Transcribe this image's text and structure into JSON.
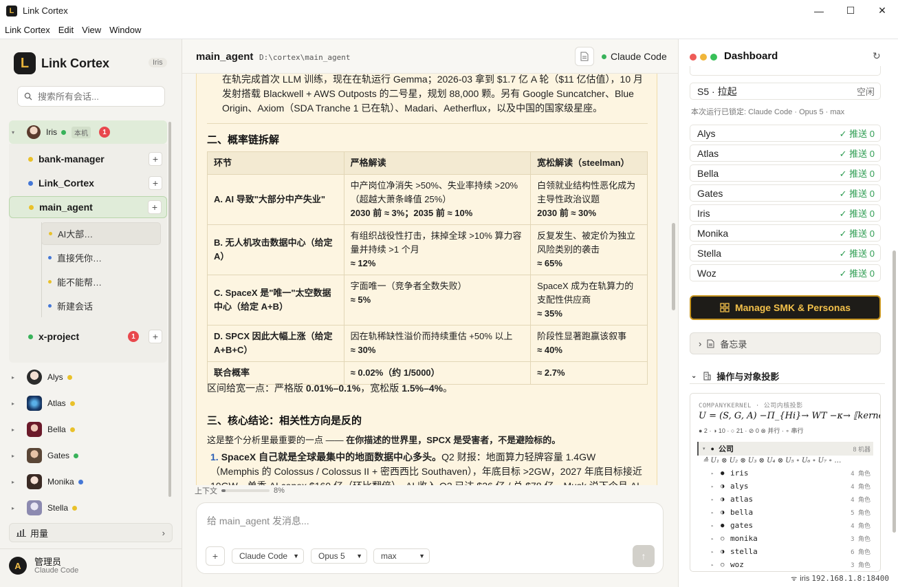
{
  "window": {
    "title": "Link Cortex",
    "controls": [
      "—",
      "☐",
      "✕"
    ]
  },
  "menu": [
    "Link Cortex",
    "Edit",
    "View",
    "Window"
  ],
  "sidebar": {
    "brand": "Link Cortex",
    "user_tag": "Iris",
    "search_placeholder": "搜索所有会话...",
    "root": {
      "name": "Iris",
      "tag": "本机",
      "badge": "1"
    },
    "projects": [
      {
        "name": "bank-manager",
        "color": "#e9c12a"
      },
      {
        "name": "Link_Cortex",
        "color": "#4477d6"
      },
      {
        "name": "main_agent",
        "color": "#e9c12a"
      },
      {
        "name": "x-project",
        "color": "#38b25a",
        "badge": "1"
      }
    ],
    "sessions": [
      {
        "label": "AI大部…",
        "color": "#e9c12a"
      },
      {
        "label": "直接凭你…",
        "color": "#4477d6"
      },
      {
        "label": "能不能帮…",
        "color": "#e9c12a"
      },
      {
        "label": "新建会话",
        "color": "#4477d6"
      }
    ],
    "people": [
      {
        "name": "Alys",
        "color": "#e9c12a"
      },
      {
        "name": "Atlas",
        "color": "#e9c12a"
      },
      {
        "name": "Bella",
        "color": "#e9c12a"
      },
      {
        "name": "Gates",
        "color": "#38b25a"
      },
      {
        "name": "Monika",
        "color": "#4477d6"
      },
      {
        "name": "Stella",
        "color": "#e9c12a"
      }
    ],
    "usage_label": "用量",
    "admin_name": "管理员",
    "admin_sub": "Claude Code",
    "admin_initial": "A"
  },
  "center": {
    "agent": "main_agent",
    "path": "D:\\cortex\\main_agent",
    "runtime": "Claude Code",
    "para_top": "在轨完成首次 LLM 训练，现在在轨运行 Gemma；2026-03 拿到 $1.7 亿 A 轮（$11 亿估值），10 月发射搭载 Blackwell + AWS Outposts 的二号星，规划 88,000 颗。另有 Google Suncatcher、Blue Origin、Axiom（SDA Tranche 1 已在轨）、Madari、Aetherflux，以及中国的国家级星座。",
    "h2": "二、概率链拆解",
    "table_headers": [
      "环节",
      "严格解读",
      "宽松解读（steelman）"
    ],
    "table_rows": [
      {
        "step": "A. AI 导致\"大部分中产失业\"",
        "strict": "中产岗位净消失 >50%、失业率持续 >20%（超越大萧条峰值 25%）",
        "strict_v": "2030 前 ≈ 3%；2035 前 ≈ 10%",
        "loose": "白领就业结构性恶化成为主导性政治议题",
        "loose_v": "2030 前 ≈ 30%"
      },
      {
        "step": "B. 无人机攻击数据中心（给定 A）",
        "strict": "有组织战役性打击，抹掉全球 >10% 算力容量并持续 >1 个月",
        "strict_v": "≈ 12%",
        "loose": "反复发生、被定价为独立风险类别的袭击",
        "loose_v": "≈ 65%"
      },
      {
        "step": "C. SpaceX 是\"唯一\"太空数据中心（给定 A+B）",
        "strict": "字面唯一（竞争者全数失败）",
        "strict_v": "≈ 5%",
        "loose": "SpaceX 成为在轨算力的支配性供应商",
        "loose_v": "≈ 35%"
      },
      {
        "step": "D. SPCX 因此大幅上涨（给定 A+B+C）",
        "strict": "因在轨稀缺性溢价而持续重估 +50% 以上",
        "strict_v": "≈ 30%",
        "loose": "阶段性显著跑赢该叙事",
        "loose_v": "≈ 40%"
      },
      {
        "step": "联合概率",
        "strict": "",
        "strict_v": "≈ 0.02%（约 1/5000）",
        "loose": "",
        "loose_v": "≈ 2.7%"
      }
    ],
    "range_pre": "区间给宽一点：严格版 ",
    "range_strict": "0.01%–0.1%",
    "range_mid": "，宽松版 ",
    "range_loose": "1.5%–4%",
    "range_post": "。",
    "h3": "三、核心结论：相关性方向是反的",
    "lead_pre": "这是整个分析里最重要的一点 —— ",
    "lead_bold": "在你描述的世界里，SPCX 是受害者，不是避险标的。",
    "li_num": "1.",
    "li_bold": "SpaceX 自己就是全球最集中的地面数据中心多头。",
    "li_text": "Q2 财报：地面算力轻牌容量 1.4GW（Memphis 的 Colossus / Colossus II + 密西西比 Southaven），年底目标 >2GW，2027 年底目标接近 10GW，单季 AI capex $160 亿（环比翻倍），AI 收入 Q2 已达 $26 亿 / 总 $78 亿，Musk 说下个月 AI 就会成",
    "context_label": "上下文",
    "context_pct": "8%",
    "context_value": 0.08,
    "composer_placeholder": "给 main_agent 发消息...",
    "sel_runtime": "Claude Code",
    "sel_model": "Opus 5",
    "sel_effort": "max"
  },
  "right": {
    "title": "Dashboard",
    "s5_name": "S5 · 拉起",
    "s5_status": "空闲",
    "locked_text": "本次运行已锁定: Claude Code · Opus 5 · max",
    "personas": [
      {
        "name": "Alys",
        "status": "✓ 推送 0"
      },
      {
        "name": "Atlas",
        "status": "✓ 推送 0"
      },
      {
        "name": "Bella",
        "status": "✓ 推送 0"
      },
      {
        "name": "Gates",
        "status": "✓ 推送 0"
      },
      {
        "name": "Iris",
        "status": "✓ 推送 0"
      },
      {
        "name": "Monika",
        "status": "✓ 推送 0"
      },
      {
        "name": "Stella",
        "status": "✓ 推送 0"
      },
      {
        "name": "Woz",
        "status": "✓ 推送 0"
      }
    ],
    "smk_button": "Manage SMK & Personas",
    "memo_label": "备忘录",
    "ops_label": "操作与对象投影",
    "kernel_title": "COMPANYKERNEL · 公司内核投影",
    "kernel_formula": "U = (S, G, A) −Π_{Hi}→ WT −κ→ ⟦kernel⟧ ↻",
    "kernel_stats": "● 2 · ◑ 10 · ○ 21 · ⊘ 0  ⊗ 并行 · ∘ 串行",
    "company_label": "公司",
    "company_count": "8 机器",
    "tensor": "≙ U₁ ⊗ U₂ ⊗ U₃ ⊗ U₄ ⊗ U₅ ∘ U₆ ∘ U₇ ∘ …",
    "kernel_rows": [
      {
        "st": "●",
        "name": "iris",
        "count": "4 角色"
      },
      {
        "st": "◑",
        "name": "alys",
        "count": "4 角色"
      },
      {
        "st": "◑",
        "name": "atlas",
        "count": "4 角色"
      },
      {
        "st": "◑",
        "name": "bella",
        "count": "5 角色"
      },
      {
        "st": "●",
        "name": "gates",
        "count": "4 角色"
      },
      {
        "st": "○",
        "name": "monika",
        "count": "3 角色"
      },
      {
        "st": "◑",
        "name": "stella",
        "count": "6 角色"
      },
      {
        "st": "○",
        "name": "woz",
        "count": "3 角色"
      }
    ],
    "footer_user": "iris",
    "footer_ip": "192.168.1.8:18400"
  }
}
